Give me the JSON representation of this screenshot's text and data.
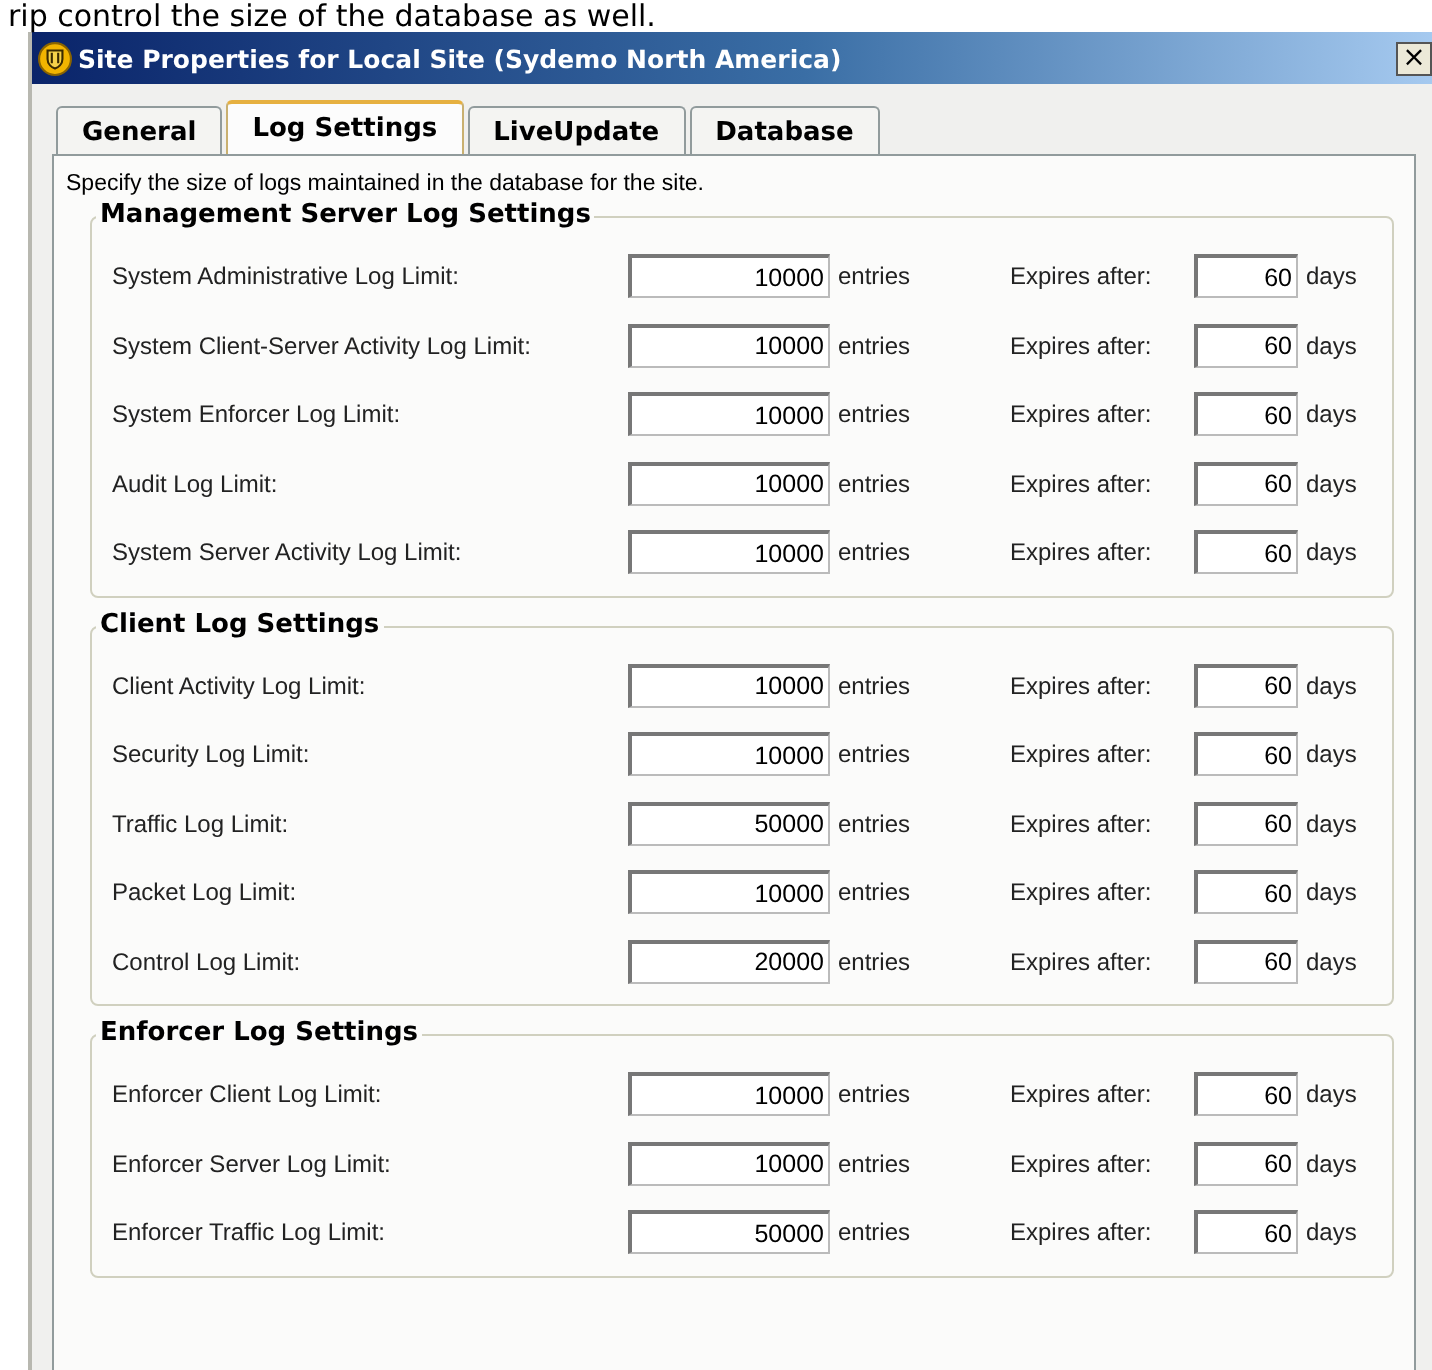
{
  "page_text": "rip control the size of the database as well.",
  "window": {
    "title": "Site Properties for Local Site (Sydemo North America)",
    "close": "×"
  },
  "tabs": [
    {
      "label": "General",
      "selected": false
    },
    {
      "label": "Log Settings",
      "selected": true
    },
    {
      "label": "LiveUpdate",
      "selected": false
    },
    {
      "label": "Database",
      "selected": false
    }
  ],
  "intro": "Specify the size of logs maintained in the database for the site.",
  "groups": [
    {
      "title": "Management Server Log Settings",
      "rows": [
        {
          "label": "System Administrative Log Limit:",
          "entries": "10000",
          "entries_unit": "entries",
          "expires_label": "Expires after:",
          "days": "60",
          "days_unit": "days"
        },
        {
          "label": "System Client-Server Activity Log Limit:",
          "entries": "10000",
          "entries_unit": "entries",
          "expires_label": "Expires after:",
          "days": "60",
          "days_unit": "days"
        },
        {
          "label": "System Enforcer Log Limit:",
          "entries": "10000",
          "entries_unit": "entries",
          "expires_label": "Expires after:",
          "days": "60",
          "days_unit": "days"
        },
        {
          "label": "Audit Log Limit:",
          "entries": "10000",
          "entries_unit": "entries",
          "expires_label": "Expires after:",
          "days": "60",
          "days_unit": "days"
        },
        {
          "label": "System Server Activity Log Limit:",
          "entries": "10000",
          "entries_unit": "entries",
          "expires_label": "Expires after:",
          "days": "60",
          "days_unit": "days"
        }
      ]
    },
    {
      "title": "Client Log Settings",
      "rows": [
        {
          "label": "Client Activity Log Limit:",
          "entries": "10000",
          "entries_unit": "entries",
          "expires_label": "Expires after:",
          "days": "60",
          "days_unit": "days"
        },
        {
          "label": "Security Log Limit:",
          "entries": "10000",
          "entries_unit": "entries",
          "expires_label": "Expires after:",
          "days": "60",
          "days_unit": "days"
        },
        {
          "label": "Traffic Log Limit:",
          "entries": "50000",
          "entries_unit": "entries",
          "expires_label": "Expires after:",
          "days": "60",
          "days_unit": "days"
        },
        {
          "label": "Packet Log Limit:",
          "entries": "10000",
          "entries_unit": "entries",
          "expires_label": "Expires after:",
          "days": "60",
          "days_unit": "days"
        },
        {
          "label": "Control Log Limit:",
          "entries": "20000",
          "entries_unit": "entries",
          "expires_label": "Expires after:",
          "days": "60",
          "days_unit": "days"
        }
      ]
    },
    {
      "title": "Enforcer Log Settings",
      "rows": [
        {
          "label": "Enforcer Client Log Limit:",
          "entries": "10000",
          "entries_unit": "entries",
          "expires_label": "Expires after:",
          "days": "60",
          "days_unit": "days"
        },
        {
          "label": "Enforcer Server Log Limit:",
          "entries": "10000",
          "entries_unit": "entries",
          "expires_label": "Expires after:",
          "days": "60",
          "days_unit": "days"
        },
        {
          "label": "Enforcer Traffic Log Limit:",
          "entries": "50000",
          "entries_unit": "entries",
          "expires_label": "Expires after:",
          "days": "60",
          "days_unit": "days"
        }
      ]
    }
  ]
}
